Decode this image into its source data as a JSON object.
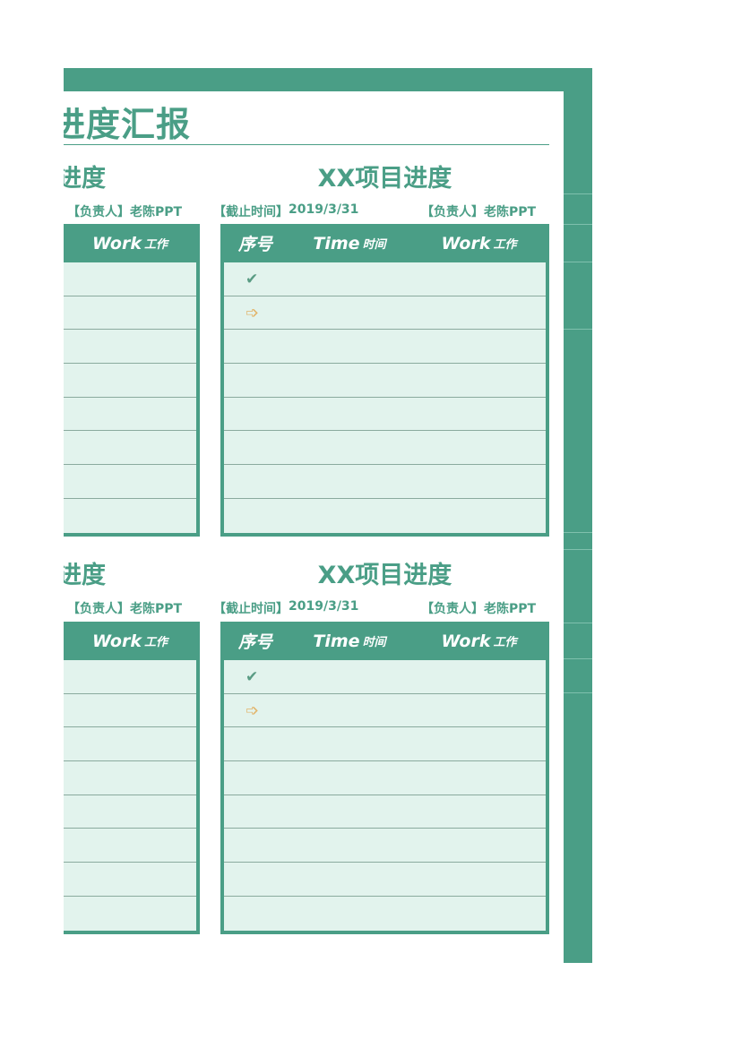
{
  "document": {
    "main_title": "进度汇报",
    "main_title_visible": "进度汇报"
  },
  "sections": [
    {
      "left_title": "进度",
      "title": "XX项目进度",
      "left_owner": "【负责人】老陈PPT",
      "deadline": "【截止时间】2019/3/31",
      "owner": "【负责人】老陈PPT",
      "left_header": {
        "en": "Work",
        "cn": "工作"
      },
      "headers": [
        {
          "en": "",
          "cn": "序号"
        },
        {
          "en": "Time",
          "cn": "时间"
        },
        {
          "en": "Work",
          "cn": "工作"
        }
      ],
      "rows": [
        {
          "status": "check-icon"
        },
        {
          "status": "arrow-right-icon"
        },
        {},
        {},
        {},
        {},
        {},
        {}
      ]
    },
    {
      "left_title": "进度",
      "title": "XX项目进度",
      "left_owner": "【负责人】老陈PPT",
      "deadline": "【截止时间】2019/3/31",
      "owner": "【负责人】老陈PPT",
      "left_header": {
        "en": "Work",
        "cn": "工作"
      },
      "headers": [
        {
          "en": "",
          "cn": "序号"
        },
        {
          "en": "Time",
          "cn": "时间"
        },
        {
          "en": "Work",
          "cn": "工作"
        }
      ],
      "rows": [
        {
          "status": "check-icon"
        },
        {
          "status": "arrow-right-icon"
        },
        {},
        {},
        {},
        {},
        {},
        {}
      ]
    }
  ],
  "icons": {
    "check": "✔",
    "arrow": "➩"
  },
  "colors": {
    "accent": "#4a9e86",
    "row_fill": "#e2f3ed",
    "arrow": "#e2b46a"
  }
}
